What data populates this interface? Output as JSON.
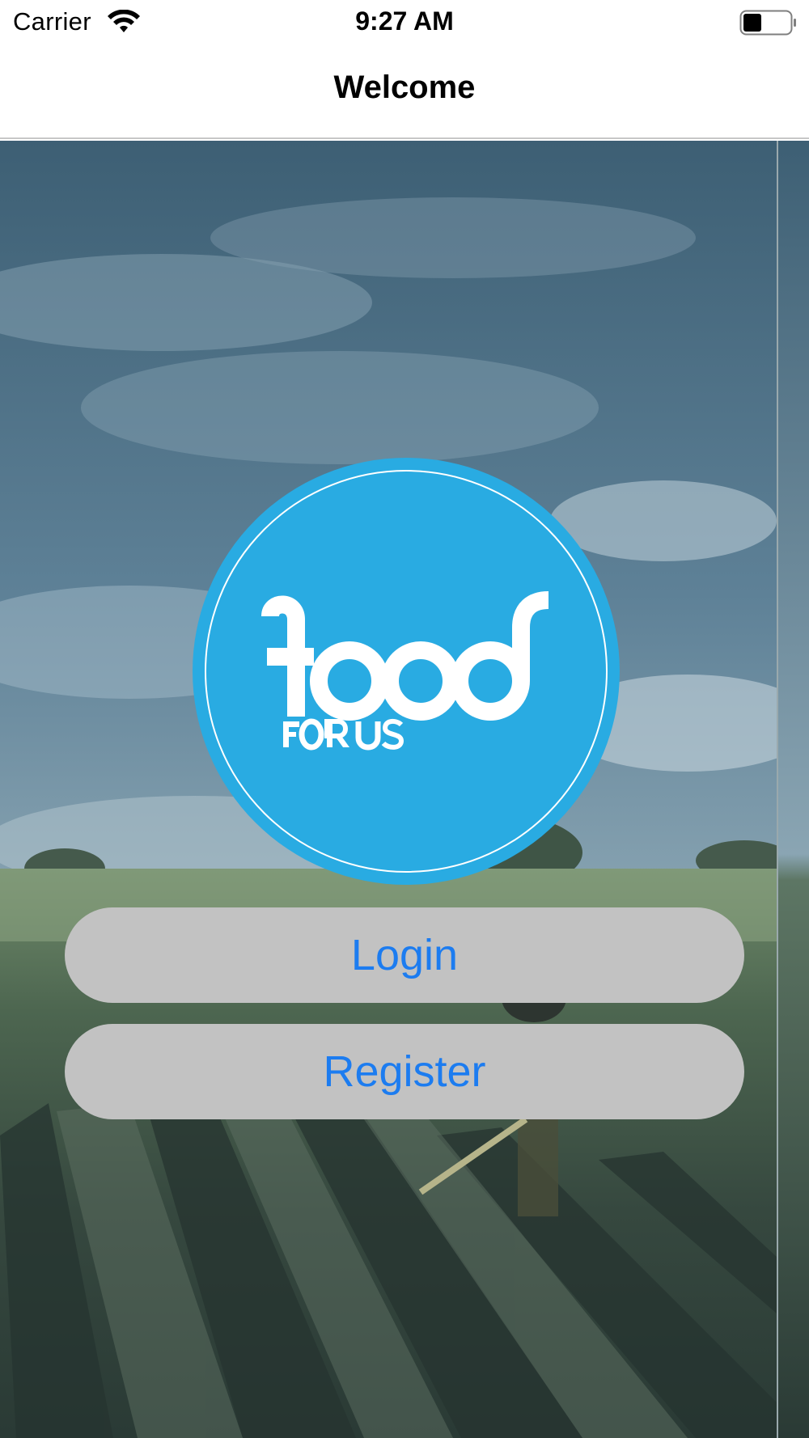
{
  "status_bar": {
    "carrier": "Carrier",
    "time": "9:27 AM",
    "wifi_icon": "wifi-icon",
    "battery_icon": "battery-icon",
    "battery_level": 0.4
  },
  "nav": {
    "title": "Welcome"
  },
  "logo": {
    "word": "food",
    "tagline": "FOR US",
    "color": "#29abe2"
  },
  "buttons": {
    "login": "Login",
    "register": "Register"
  },
  "colors": {
    "button_bg": "#c2c2c2",
    "button_text": "#1c7cf0",
    "logo_blue": "#29abe2"
  }
}
